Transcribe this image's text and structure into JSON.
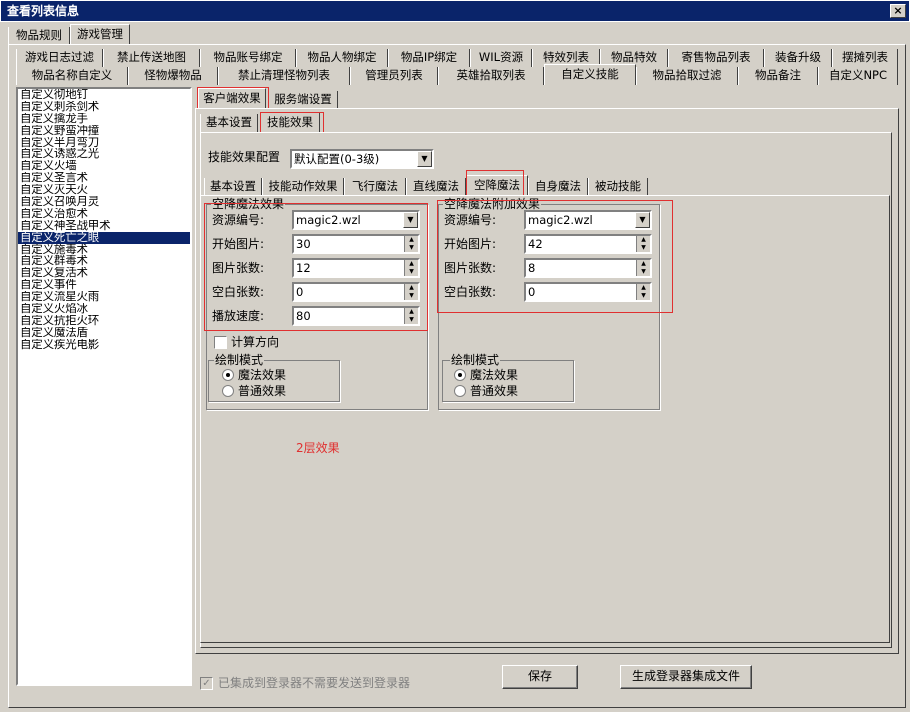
{
  "window": {
    "title": "查看列表信息",
    "close": "×"
  },
  "top_tabs": [
    "物品规则",
    "游戏管理"
  ],
  "category_tabs_row1": [
    "游戏日志过滤",
    "禁止传送地图",
    "物品账号绑定",
    "物品人物绑定",
    "物品IP绑定",
    "WIL资源",
    "特效列表",
    "物品特效",
    "寄售物品列表",
    "装备升级",
    "摆摊列表"
  ],
  "category_tabs_row2": [
    "物品名称自定义",
    "怪物爆物品",
    "禁止清理怪物列表",
    "管理员列表",
    "英雄拾取列表",
    "自定义技能",
    "物品拾取过滤",
    "物品备注",
    "自定义NPC"
  ],
  "skill_list": [
    "自定义彻地钉",
    "自定义刺杀剑术",
    "自定义擒龙手",
    "自定义野蛮冲撞",
    "自定义半月弯刀",
    "自定义诱惑之光",
    "自定义火墙",
    "自定义圣言术",
    "自定义灭天火",
    "自定义召唤月灵",
    "自定义治愈术",
    "自定义神圣战甲术",
    "自定义死亡之眼",
    "自定义施毒术",
    "自定义群毒术",
    "自定义复活术",
    "自定义事件",
    "自定义流星火雨",
    "自定义火焰冰",
    "自定义抗拒火环",
    "自定义魔法盾",
    "自定义疾光电影"
  ],
  "skill_list_selected": 12,
  "effect_tabs": [
    "客户端效果",
    "服务端设置"
  ],
  "sub_tabs": [
    "基本设置",
    "技能效果"
  ],
  "config": {
    "label": "技能效果配置",
    "value": "默认配置(0-3级)"
  },
  "magic_tabs": [
    "基本设置",
    "技能动作效果",
    "飞行魔法",
    "直线魔法",
    "空降魔法",
    "自身魔法",
    "被动技能"
  ],
  "left_group": {
    "title": "空降魔法效果",
    "fields": [
      {
        "label": "资源编号:",
        "value": "magic2.wzl"
      },
      {
        "label": "开始图片:",
        "value": "30"
      },
      {
        "label": "图片张数:",
        "value": "12"
      },
      {
        "label": "空白张数:",
        "value": "0"
      },
      {
        "label": "播放速度:",
        "value": "80"
      }
    ],
    "calc_direction": "计算方向",
    "draw_mode": {
      "title": "绘制模式",
      "options": [
        "魔法效果",
        "普通效果"
      ]
    }
  },
  "right_group": {
    "title": "空降魔法附加效果",
    "fields": [
      {
        "label": "资源编号:",
        "value": "magic2.wzl"
      },
      {
        "label": "开始图片:",
        "value": "42"
      },
      {
        "label": "图片张数:",
        "value": "8"
      },
      {
        "label": "空白张数:",
        "value": "0"
      }
    ],
    "draw_mode": {
      "title": "绘制模式",
      "options": [
        "魔法效果",
        "普通效果"
      ]
    }
  },
  "annotation": "2层效果",
  "footer": {
    "integrated_check": "已集成到登录器不需要发送到登录器",
    "save": "保存",
    "generate": "生成登录器集成文件"
  },
  "colors": {
    "title_bar": "#0a246a",
    "face": "#d4d0c8",
    "annotation_red": "#e03030"
  }
}
